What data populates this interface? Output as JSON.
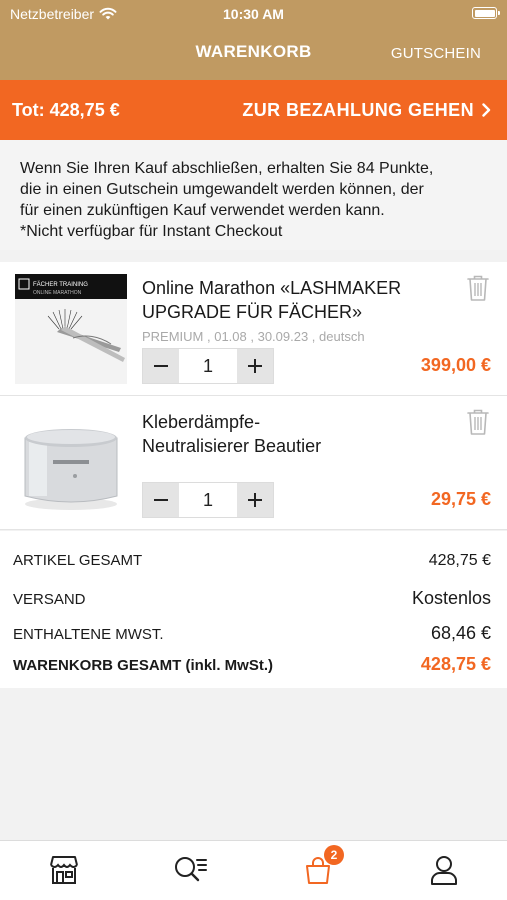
{
  "status_bar": {
    "carrier": "Netzbetreiber",
    "time": "10:30 AM"
  },
  "nav": {
    "title": "WARENKORB",
    "right_label": "GUTSCHEIN"
  },
  "checkout": {
    "total": "Tot: 428,75 €",
    "pay_label": "ZUR BEZAHLUNG GEHEN"
  },
  "info": {
    "line1": "Wenn Sie Ihren Kauf abschließen, erhalten Sie  84 Punkte,",
    "line2": "die in einen Gutschein umgewandelt werden können, der",
    "line3": "für einen zukünftigen Kauf verwendet werden kann.",
    "line4": "*Nicht verfügbar für Instant Checkout"
  },
  "items": [
    {
      "title_line1": "Online Marathon «LASHMAKER",
      "title_line2": "UPGRADE FÜR FÄCHER»",
      "meta": "PREMIUM , 01.08 , 30.09.23 , deutsch",
      "qty": "1",
      "price": "399,00 €",
      "thumb_text_line1": "FÄCHER TRAINING",
      "thumb_text_line2": "ONLINE MARATHON"
    },
    {
      "title_line1": "Kleberdämpfe-",
      "title_line2": "Neutralisierer Beautier",
      "meta": "",
      "qty": "1",
      "price": "29,75 €"
    }
  ],
  "totals": {
    "items_label": "ARTIKEL GESAMT",
    "items_value": "428,75 €",
    "shipping_label": "VERSAND",
    "shipping_value": "Kostenlos",
    "tax_label": "ENTHALTENE MWST.",
    "tax_value": "68,46 €",
    "cart_label": "WARENKORB GESAMT (inkl. MwSt.)",
    "cart_value": "428,75 €"
  },
  "tabbar": {
    "tabs": [
      "store-icon",
      "search-list-icon",
      "cart-icon",
      "user-icon"
    ],
    "active": "cart-icon",
    "cart_badge": "2"
  },
  "colors": {
    "header": "#c09a62",
    "accent": "#f26722"
  }
}
